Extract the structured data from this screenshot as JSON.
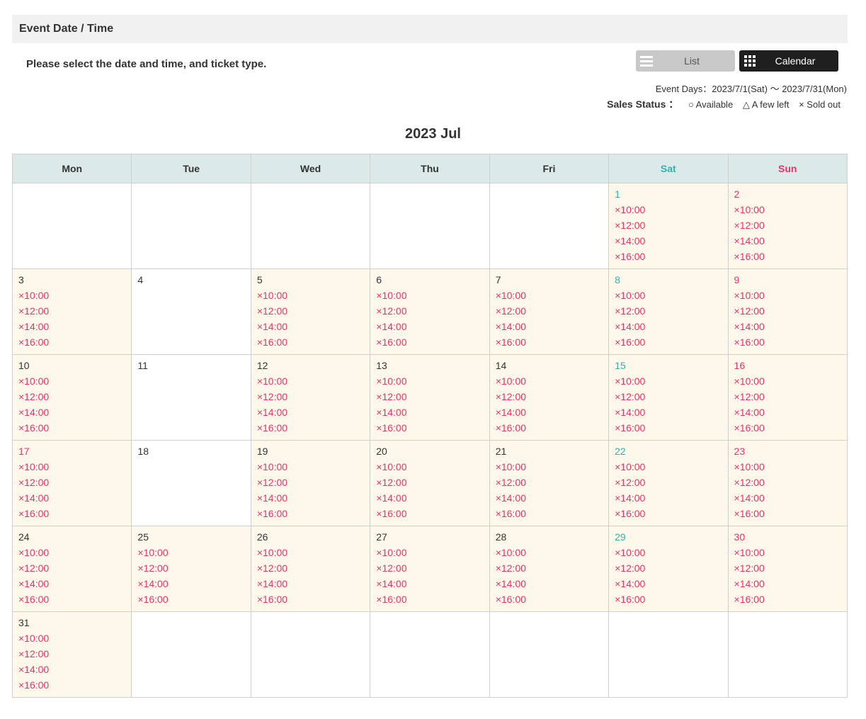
{
  "header": {
    "title": "Event Date / Time"
  },
  "instruction": "Please select the date and time, and ticket type.",
  "view_toggle": {
    "list_label": "List",
    "calendar_label": "Calendar",
    "list_icon": "list-icon",
    "calendar_icon": "grid-icon"
  },
  "event_days": "Event Days：2023/7/1(Sat) 〜 2023/7/31(Mon)",
  "sales_status": {
    "title": "Sales Status ：",
    "available": "○ Available",
    "few_left": "△ A few left",
    "sold_out": "× Sold out"
  },
  "calendar": {
    "month_title": "2023 Jul",
    "weekdays": [
      "Mon",
      "Tue",
      "Wed",
      "Thu",
      "Fri",
      "Sat",
      "Sun"
    ],
    "weeks": [
      [
        null,
        null,
        null,
        null,
        null,
        {
          "day": "1",
          "slots": [
            "×10:00",
            "×12:00",
            "×14:00",
            "×16:00"
          ]
        },
        {
          "day": "2",
          "slots": [
            "×10:00",
            "×12:00",
            "×14:00",
            "×16:00"
          ]
        }
      ],
      [
        {
          "day": "3",
          "slots": [
            "×10:00",
            "×12:00",
            "×14:00",
            "×16:00"
          ]
        },
        {
          "day": "4",
          "slots": []
        },
        {
          "day": "5",
          "slots": [
            "×10:00",
            "×12:00",
            "×14:00",
            "×16:00"
          ]
        },
        {
          "day": "6",
          "slots": [
            "×10:00",
            "×12:00",
            "×14:00",
            "×16:00"
          ]
        },
        {
          "day": "7",
          "slots": [
            "×10:00",
            "×12:00",
            "×14:00",
            "×16:00"
          ]
        },
        {
          "day": "8",
          "slots": [
            "×10:00",
            "×12:00",
            "×14:00",
            "×16:00"
          ]
        },
        {
          "day": "9",
          "slots": [
            "×10:00",
            "×12:00",
            "×14:00",
            "×16:00"
          ]
        }
      ],
      [
        {
          "day": "10",
          "slots": [
            "×10:00",
            "×12:00",
            "×14:00",
            "×16:00"
          ]
        },
        {
          "day": "11",
          "slots": []
        },
        {
          "day": "12",
          "slots": [
            "×10:00",
            "×12:00",
            "×14:00",
            "×16:00"
          ]
        },
        {
          "day": "13",
          "slots": [
            "×10:00",
            "×12:00",
            "×14:00",
            "×16:00"
          ]
        },
        {
          "day": "14",
          "slots": [
            "×10:00",
            "×12:00",
            "×14:00",
            "×16:00"
          ]
        },
        {
          "day": "15",
          "slots": [
            "×10:00",
            "×12:00",
            "×14:00",
            "×16:00"
          ]
        },
        {
          "day": "16",
          "slots": [
            "×10:00",
            "×12:00",
            "×14:00",
            "×16:00"
          ]
        }
      ],
      [
        {
          "day": "17",
          "slots": [
            "×10:00",
            "×12:00",
            "×14:00",
            "×16:00"
          ],
          "holiday": true
        },
        {
          "day": "18",
          "slots": []
        },
        {
          "day": "19",
          "slots": [
            "×10:00",
            "×12:00",
            "×14:00",
            "×16:00"
          ]
        },
        {
          "day": "20",
          "slots": [
            "×10:00",
            "×12:00",
            "×14:00",
            "×16:00"
          ]
        },
        {
          "day": "21",
          "slots": [
            "×10:00",
            "×12:00",
            "×14:00",
            "×16:00"
          ]
        },
        {
          "day": "22",
          "slots": [
            "×10:00",
            "×12:00",
            "×14:00",
            "×16:00"
          ]
        },
        {
          "day": "23",
          "slots": [
            "×10:00",
            "×12:00",
            "×14:00",
            "×16:00"
          ]
        }
      ],
      [
        {
          "day": "24",
          "slots": [
            "×10:00",
            "×12:00",
            "×14:00",
            "×16:00"
          ]
        },
        {
          "day": "25",
          "slots": [
            "×10:00",
            "×12:00",
            "×14:00",
            "×16:00"
          ]
        },
        {
          "day": "26",
          "slots": [
            "×10:00",
            "×12:00",
            "×14:00",
            "×16:00"
          ]
        },
        {
          "day": "27",
          "slots": [
            "×10:00",
            "×12:00",
            "×14:00",
            "×16:00"
          ]
        },
        {
          "day": "28",
          "slots": [
            "×10:00",
            "×12:00",
            "×14:00",
            "×16:00"
          ]
        },
        {
          "day": "29",
          "slots": [
            "×10:00",
            "×12:00",
            "×14:00",
            "×16:00"
          ]
        },
        {
          "day": "30",
          "slots": [
            "×10:00",
            "×12:00",
            "×14:00",
            "×16:00"
          ]
        }
      ],
      [
        {
          "day": "31",
          "slots": [
            "×10:00",
            "×12:00",
            "×14:00",
            "×16:00"
          ]
        },
        null,
        null,
        null,
        null,
        null,
        null
      ]
    ]
  },
  "colors": {
    "sold_out": "#e5336d",
    "saturday": "#32b1ad",
    "sunday": "#e5336d",
    "active_cell": "#fdf8ea",
    "header_row": "#dbe9e9"
  }
}
